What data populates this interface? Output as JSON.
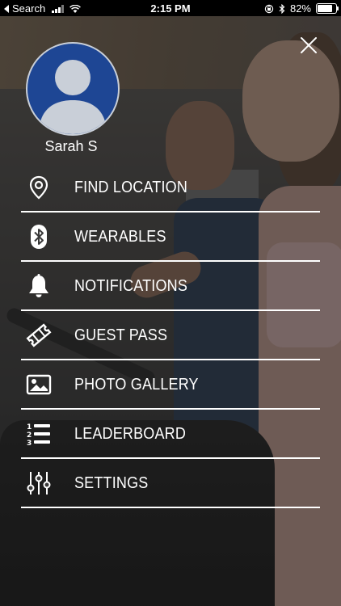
{
  "status_bar": {
    "back_app": "Search",
    "time": "2:15 PM",
    "battery_percent": "82%",
    "battery_level": 0.82
  },
  "profile": {
    "name": "Sarah S",
    "avatar_bg_color": "#1e4694"
  },
  "menu": {
    "items": [
      {
        "label": "FIND LOCATION",
        "icon": "location-pin-icon"
      },
      {
        "label": "WEARABLES",
        "icon": "bluetooth-icon"
      },
      {
        "label": "NOTIFICATIONS",
        "icon": "bell-icon"
      },
      {
        "label": "GUEST PASS",
        "icon": "ticket-icon"
      },
      {
        "label": "PHOTO GALLERY",
        "icon": "photo-icon"
      },
      {
        "label": "LEADERBOARD",
        "icon": "numbered-list-icon"
      },
      {
        "label": "SETTINGS",
        "icon": "sliders-icon"
      }
    ]
  }
}
